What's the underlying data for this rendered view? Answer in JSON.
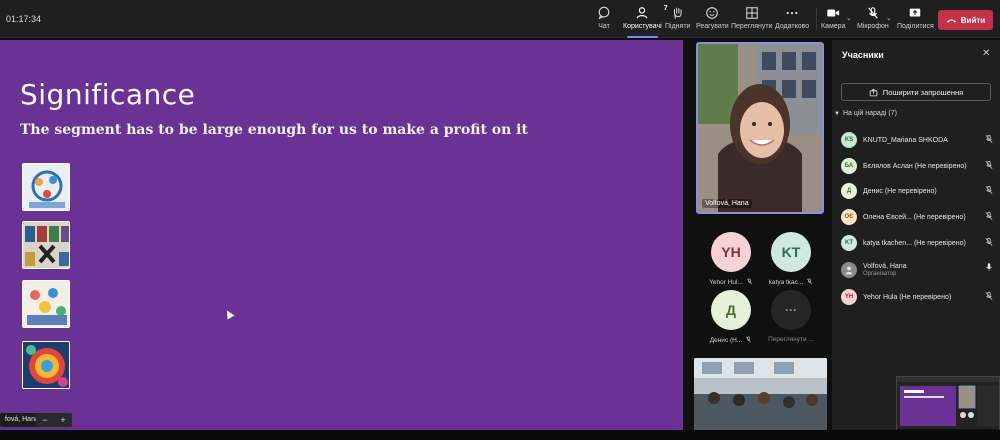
{
  "header": {
    "timer": "01:17:34",
    "participants_count": "7",
    "buttons": {
      "chat": "Чат",
      "people": "Користувачі",
      "raise": "Підняти",
      "react": "Реагувати",
      "view": "Переглянути",
      "apps": "Додатково",
      "camera": "Камера",
      "mic": "Мікрофон",
      "share": "Поділитися",
      "leave": "Вийти"
    },
    "colors": {
      "leave": "#c4314b",
      "accent": "#7f85f5"
    }
  },
  "slide": {
    "title": "Significance",
    "subtitle": "The segment has to be large enough for us to make a profit on it",
    "background": "#6a3294",
    "presenter_label": "fová, Hana",
    "zoom_out": "−",
    "zoom_in": "+"
  },
  "videos": {
    "main_name": "Volfová, Hana",
    "tiles": [
      {
        "initials": "YH",
        "name": "Yehor Hul..."
      },
      {
        "initials": "KT",
        "name": "katya tkac..."
      },
      {
        "initials": "Д",
        "name": "Денис (Н..."
      },
      {
        "initials": "···",
        "name": "Переглянути ..."
      }
    ]
  },
  "panel": {
    "title": "Учасники",
    "share_invite": "Поширити запрошення",
    "section": "На цій нараді (7)",
    "participants": [
      {
        "initials": "KS",
        "name": "KNUTD_Mariana SHKODA",
        "color": "#c8e6d0"
      },
      {
        "initials": "БА",
        "name": "Бєлялов Аслан (Не перевірено)",
        "color": "#dff0d8"
      },
      {
        "initials": "Д",
        "name": "Денис (Не перевірено)",
        "color": "#e7f1d9"
      },
      {
        "initials": "ОЄ",
        "name": "Олена Євсей... (Не перевірено)",
        "color": "#fbe3c4"
      },
      {
        "initials": "KT",
        "name": "katya tkachen... (Не перевірено)",
        "color": "#cfe8e0"
      },
      {
        "initials": "",
        "name": "Volfová, Hana",
        "sub": "Організатор",
        "color": "#8a8a8a"
      },
      {
        "initials": "YH",
        "name": "Yehor Hula (Не перевірено)",
        "color": "#f6d2d6"
      }
    ]
  }
}
